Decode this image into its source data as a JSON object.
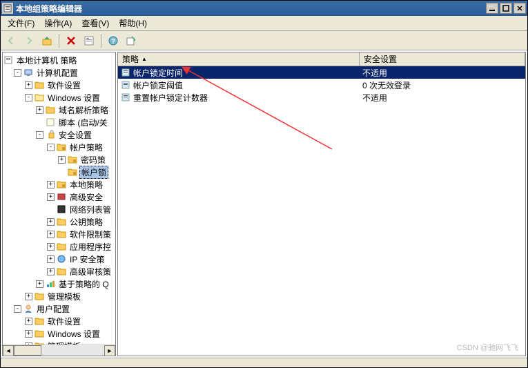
{
  "window": {
    "title": "本地组策略编辑器"
  },
  "menu": {
    "file": "文件(F)",
    "action": "操作(A)",
    "view": "查看(V)",
    "help": "帮助(H)"
  },
  "toolbar": {
    "back": "back",
    "forward": "forward",
    "up": "up",
    "delete": "delete",
    "refresh": "refresh",
    "export": "export",
    "help": "help"
  },
  "tree": {
    "root": "本地计算机 策略",
    "computer_config": "计算机配置",
    "software_settings": "软件设置",
    "windows_settings": "Windows 设置",
    "name_resolution": "域名解析策略",
    "scripts": "脚本 (启动/关",
    "security_settings": "安全设置",
    "account_policies": "帐户策略",
    "password_policy": "密码策",
    "account_lockout": "帐户锁",
    "local_policies": "本地策略",
    "advanced_security": "高级安全",
    "network_list": "网络列表管",
    "public_key": "公钥策略",
    "software_restrict": "软件限制策",
    "app_control": "应用程序控",
    "ip_security": "IP 安全策",
    "advanced_audit": "高级审核策",
    "policy_based_q": "基于策略的 Q",
    "admin_templates": "管理模板",
    "user_config": "用户配置",
    "u_software": "软件设置",
    "u_windows": "Windows 设置",
    "u_admin": "管理模板"
  },
  "list": {
    "col_policy": "策略",
    "col_security": "安全设置",
    "rows": [
      {
        "policy": "帐户锁定时间",
        "value": "不适用",
        "selected": true
      },
      {
        "policy": "帐户锁定阈值",
        "value": "0 次无效登录",
        "selected": false
      },
      {
        "policy": "重置帐户锁定计数器",
        "value": "不适用",
        "selected": false
      }
    ]
  },
  "watermark": "CSDN @驰网飞飞"
}
